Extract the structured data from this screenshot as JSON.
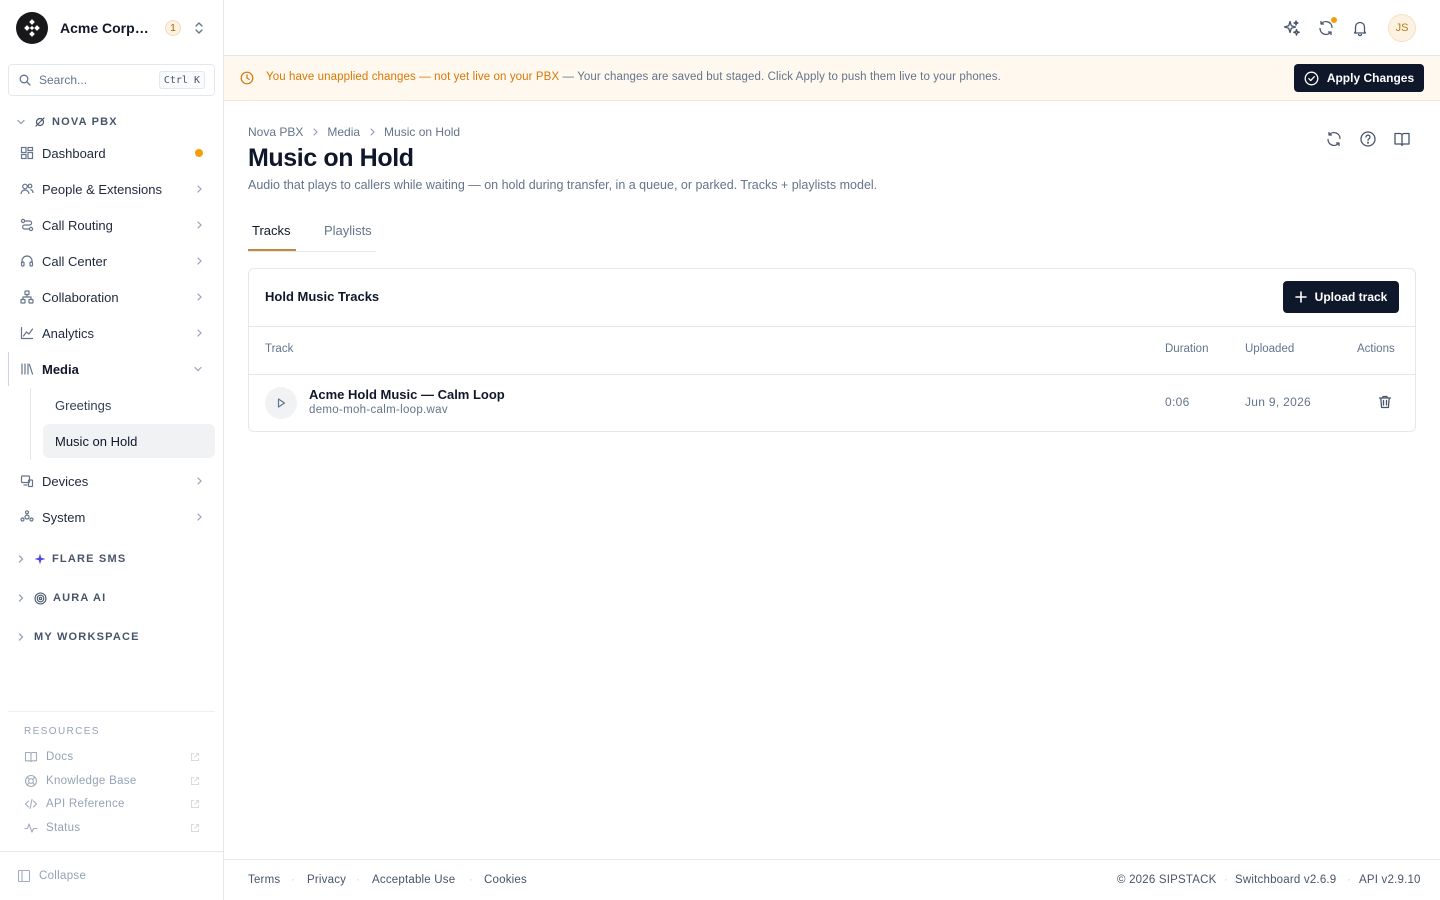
{
  "org": {
    "name": "Acme Corporation",
    "badge_count": "1"
  },
  "search": {
    "placeholder": "Search...",
    "shortcut": "Ctrl K"
  },
  "sections": {
    "nova": "NOVA PBX",
    "flare": "FLARE SMS",
    "aura": "AURA AI",
    "workspace": "MY WORKSPACE"
  },
  "nav": [
    {
      "label": "Dashboard",
      "icon": "dashboard-icon",
      "indicator": "dot"
    },
    {
      "label": "People & Extensions",
      "icon": "people-icon",
      "indicator": "chevron"
    },
    {
      "label": "Call Routing",
      "icon": "routing-icon",
      "indicator": "chevron"
    },
    {
      "label": "Call Center",
      "icon": "headset-icon",
      "indicator": "chevron"
    },
    {
      "label": "Collaboration",
      "icon": "collaboration-icon",
      "indicator": "chevron"
    },
    {
      "label": "Analytics",
      "icon": "analytics-icon",
      "indicator": "chevron"
    },
    {
      "label": "Media",
      "icon": "media-library-icon",
      "indicator": "chevron-down",
      "expanded": true
    },
    {
      "label": "Devices",
      "icon": "devices-icon",
      "indicator": "chevron"
    },
    {
      "label": "System",
      "icon": "system-icon",
      "indicator": "chevron"
    }
  ],
  "media_sub": [
    {
      "label": "Greetings",
      "selected": false
    },
    {
      "label": "Music on Hold",
      "selected": true
    }
  ],
  "resources": {
    "title": "RESOURCES",
    "items": [
      {
        "label": "Docs",
        "icon": "book-icon"
      },
      {
        "label": "Knowledge Base",
        "icon": "lifebuoy-icon"
      },
      {
        "label": "API Reference",
        "icon": "code-icon"
      },
      {
        "label": "Status",
        "icon": "activity-icon"
      }
    ]
  },
  "collapse_label": "Collapse",
  "user": {
    "initials": "JS"
  },
  "banner": {
    "highlight": "You have unapplied changes — not yet live on your PBX",
    "message": " — Your changes are saved but staged. Click Apply to push them live to your phones.",
    "apply_label": "Apply Changes"
  },
  "breadcrumb": [
    "Nova PBX",
    "Media",
    "Music on Hold"
  ],
  "page": {
    "title": "Music on Hold",
    "subtitle": "Audio that plays to callers while waiting — on hold during transfer, in a queue, or parked. Tracks + playlists model."
  },
  "tabs": [
    {
      "label": "Tracks",
      "active": true
    },
    {
      "label": "Playlists",
      "active": false
    }
  ],
  "card": {
    "title": "Hold Music Tracks",
    "upload_label": "Upload track",
    "columns": {
      "track": "Track",
      "duration": "Duration",
      "uploaded": "Uploaded",
      "actions": "Actions"
    },
    "rows": [
      {
        "name": "Acme Hold Music — Calm Loop",
        "file": "demo-moh-calm-loop.wav",
        "duration": "0:06",
        "uploaded": "Jun 9, 2026"
      }
    ]
  },
  "footer": {
    "links": [
      "Terms",
      "Privacy",
      "Acceptable Use",
      "Cookies"
    ],
    "copyright": "© 2026 SIPSTACK",
    "version": "Switchboard v2.6.9",
    "api": "API v2.9.10"
  },
  "colors": {
    "accent": "#f59e0b",
    "primary_button": "#0f172a",
    "banner_bg": "#fff8ef",
    "banner_text": "#d97706"
  }
}
